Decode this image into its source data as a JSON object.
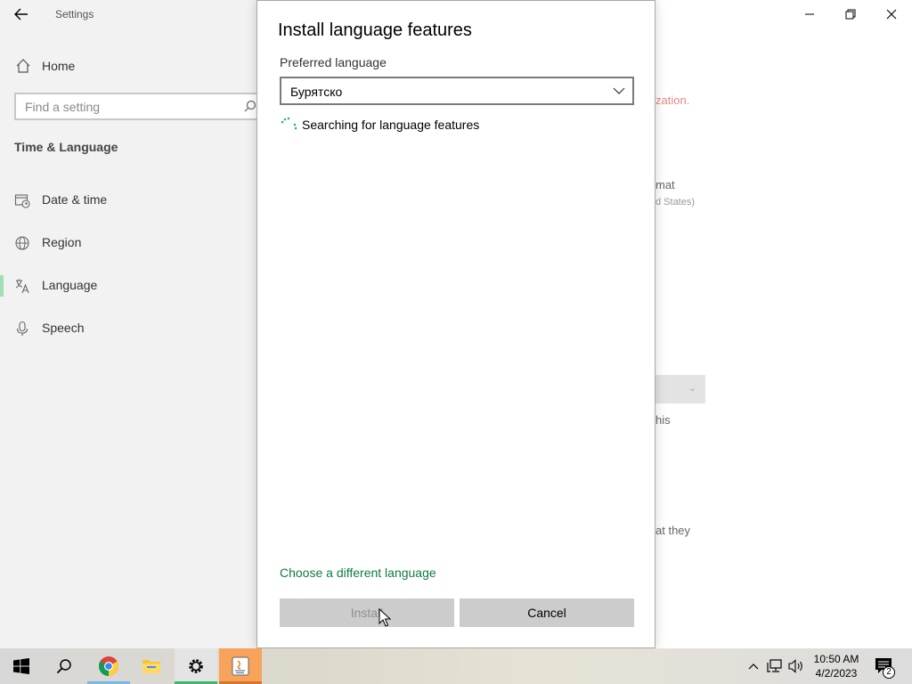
{
  "window": {
    "title": "Settings",
    "back_icon": "back-arrow-icon"
  },
  "sidebar": {
    "home_label": "Home",
    "search_placeholder": "Find a setting",
    "section_title": "Time & Language",
    "items": [
      {
        "label": "Date & time",
        "icon": "calendar-clock-icon"
      },
      {
        "label": "Region",
        "icon": "globe-icon"
      },
      {
        "label": "Language",
        "icon": "language-icon",
        "selected": true
      },
      {
        "label": "Speech",
        "icon": "microphone-icon"
      }
    ]
  },
  "background": {
    "text_red": "zation.",
    "text_format": "mat",
    "text_states": "d States)",
    "text_this": "his",
    "text_they": "at they"
  },
  "dialog": {
    "title": "Install language features",
    "preferred_label": "Preferred language",
    "selected_language": "Бурятско",
    "status": "Searching for language features",
    "link": "Choose a different language",
    "install_label": "Install",
    "cancel_label": "Cancel"
  },
  "taskbar": {
    "apps": [
      "start-icon",
      "search-icon",
      "chrome-icon",
      "file-explorer-icon",
      "settings-icon",
      "java-icon"
    ],
    "time": "10:50 AM",
    "date": "4/2/2023",
    "notification_count": "2"
  },
  "colors": {
    "accent_green": "#107c41",
    "error_red": "#e38a8a",
    "selection_bar": "#9fe0b4",
    "active_app": "#f7a35c"
  }
}
